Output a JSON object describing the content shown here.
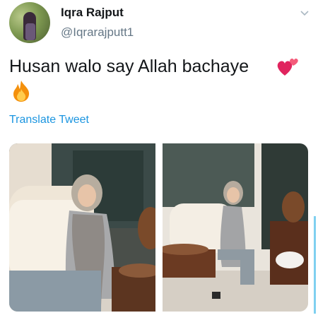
{
  "tweet": {
    "author_name": "Iqra Rajput",
    "author_handle": "@Iqrarajputt1",
    "text": "Husan walo say Allah bachaye",
    "translate_label": "Translate Tweet"
  },
  "icons": {
    "menu": "chevron-down-icon",
    "emoji_1": "two-hearts-emoji",
    "emoji_2": "fire-emoji"
  },
  "colors": {
    "link": "#1b95e0",
    "secondary_text": "#657786",
    "primary_text": "#14171a"
  }
}
